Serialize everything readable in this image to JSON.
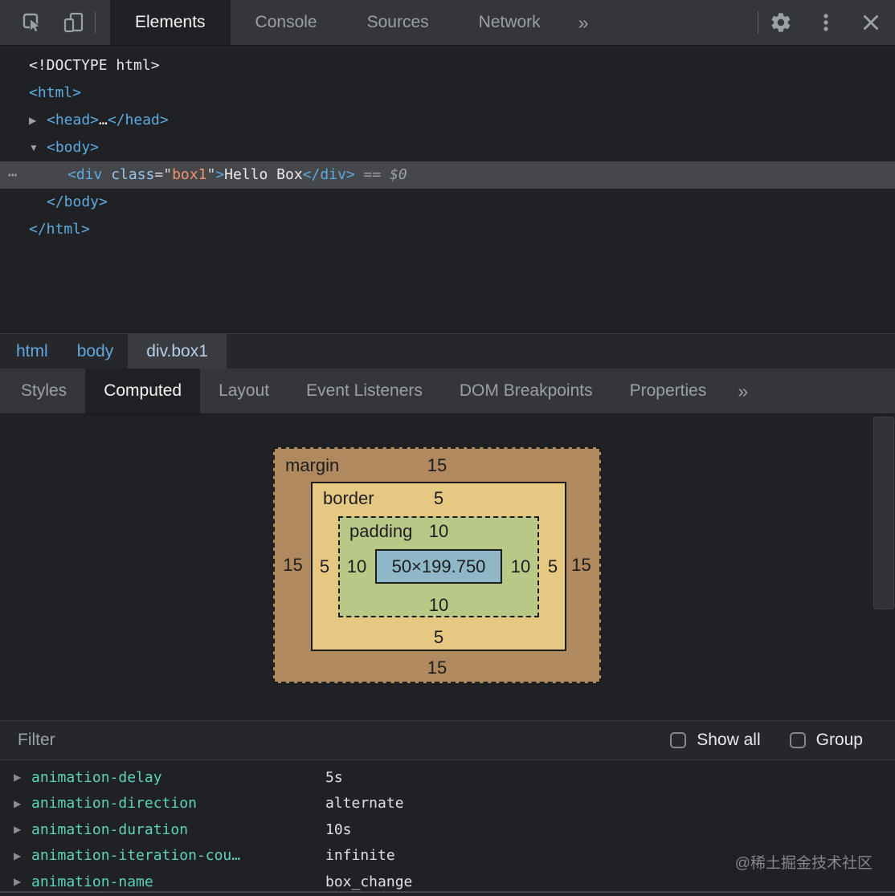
{
  "toolbar": {
    "tabs": [
      "Elements",
      "Console",
      "Sources",
      "Network"
    ],
    "active_tab": "Elements",
    "overflow_label": "»",
    "left_icons": [
      "inspect-element",
      "device-toolbar"
    ],
    "right_icons": [
      "settings",
      "more-options",
      "close"
    ]
  },
  "elements_panel": {
    "lines": [
      {
        "indent": 36,
        "tokens": [
          {
            "c": "plain",
            "t": "<!DOCTYPE html>"
          }
        ]
      },
      {
        "indent": 36,
        "tokens": [
          {
            "c": "tag",
            "t": "<html>"
          }
        ]
      },
      {
        "indent": 58,
        "arrow": "collapsed",
        "tokens": [
          {
            "c": "tag",
            "t": "<head>"
          },
          {
            "c": "plain",
            "t": "…"
          },
          {
            "c": "tag",
            "t": "</head>"
          }
        ]
      },
      {
        "indent": 58,
        "arrow": "expanded",
        "tokens": [
          {
            "c": "tag",
            "t": "<body>"
          }
        ]
      },
      {
        "indent": 84,
        "selected": true,
        "gutter": true,
        "tokens": [
          {
            "c": "tag",
            "t": "<div"
          },
          {
            "c": "plain",
            "t": " "
          },
          {
            "c": "attr",
            "t": "class"
          },
          {
            "c": "punct",
            "t": "=\""
          },
          {
            "c": "str",
            "t": "box1"
          },
          {
            "c": "punct",
            "t": "\""
          },
          {
            "c": "tag",
            "t": ">"
          },
          {
            "c": "plain",
            "t": "Hello Box"
          },
          {
            "c": "tag",
            "t": "</div>"
          },
          {
            "c": "fade",
            "t": " == "
          },
          {
            "c": "fadeit",
            "t": "$0"
          }
        ]
      },
      {
        "indent": 58,
        "tokens": [
          {
            "c": "tag",
            "t": "</body>"
          }
        ]
      },
      {
        "indent": 36,
        "tokens": [
          {
            "c": "tag",
            "t": "</html>"
          }
        ]
      }
    ]
  },
  "breadcrumb": {
    "items": [
      {
        "label": "html"
      },
      {
        "label": "body"
      },
      {
        "label": "div.box1",
        "selected": true
      }
    ]
  },
  "sidebar_tabs": {
    "tabs": [
      "Styles",
      "Computed",
      "Layout",
      "Event Listeners",
      "DOM Breakpoints",
      "Properties"
    ],
    "active_tab": "Computed",
    "overflow_label": "»"
  },
  "box_model": {
    "margin": {
      "label": "margin",
      "top": "15",
      "right": "15",
      "bottom": "15",
      "left": "15"
    },
    "border": {
      "label": "border",
      "top": "5",
      "right": "5",
      "bottom": "5",
      "left": "5"
    },
    "padding": {
      "label": "padding",
      "top": "10",
      "right": "10",
      "bottom": "10",
      "left": "10"
    },
    "content": {
      "size": "50×199.750"
    }
  },
  "filter_bar": {
    "filter_placeholder": "Filter",
    "show_all_label": "Show all",
    "show_all_checked": false,
    "group_label": "Group",
    "group_checked": false
  },
  "computed": {
    "properties": [
      {
        "name": "animation-delay",
        "value": "5s"
      },
      {
        "name": "animation-direction",
        "value": "alternate"
      },
      {
        "name": "animation-duration",
        "value": "10s"
      },
      {
        "name": "animation-iteration-cou…",
        "value": "infinite"
      },
      {
        "name": "animation-name",
        "value": "box_change"
      }
    ]
  },
  "watermark": "@稀土掘金技术社区",
  "colors": {
    "toolbar_bg": "#35363A",
    "panel_bg": "#202124",
    "selected_row": "#45474B",
    "tag": "#5CAADF",
    "attr_value": "#F0956A",
    "computed_name": "#5DD3BD",
    "margin_fill": "#B08A5E",
    "border_fill": "#E6C883",
    "padding_fill": "#B9C887",
    "content_fill": "#8FB7C7"
  }
}
